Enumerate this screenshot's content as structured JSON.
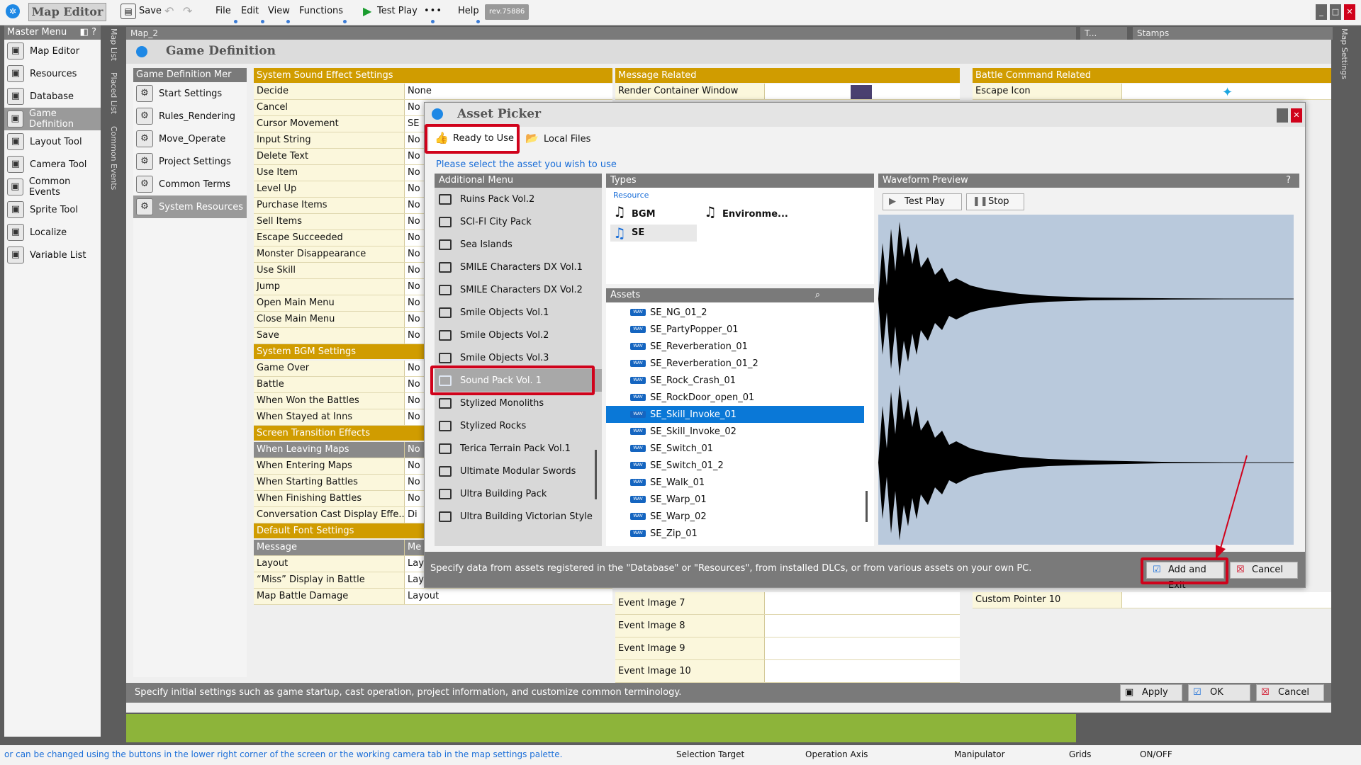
{
  "menubar": {
    "app_title": "Map Editor",
    "save": "Save",
    "file": "File",
    "edit": "Edit",
    "view": "View",
    "functions": "Functions",
    "test_play": "Test Play",
    "more": "•••",
    "help": "Help",
    "revision": "rev.75886"
  },
  "master_menu": {
    "title": "Master Menu",
    "items": [
      {
        "label": "Map Editor",
        "icon": "map-editor-icon"
      },
      {
        "label": "Resources",
        "icon": "resources-icon"
      },
      {
        "label": "Database",
        "icon": "database-icon"
      },
      {
        "label": "Game Definition",
        "icon": "game-definition-icon"
      },
      {
        "label": "Layout Tool",
        "icon": "layout-tool-icon"
      },
      {
        "label": "Camera Tool",
        "icon": "camera-icon"
      },
      {
        "label": "Common Events",
        "icon": "common-events-icon"
      },
      {
        "label": "Sprite Tool",
        "icon": "sprite-tool-icon"
      },
      {
        "label": "Localize",
        "icon": "localize-icon"
      },
      {
        "label": "Variable List",
        "icon": "variable-list-icon"
      }
    ],
    "selected": "Game Definition"
  },
  "side_tabs": {
    "map_list": "Map List",
    "placed_list": "Placed List",
    "common_events": "Common Events",
    "map_settings": "Map Settings"
  },
  "map_tab": "Map_2",
  "top_right_tabs": {
    "t": "T...",
    "stamps": "Stamps"
  },
  "game_definition": {
    "title": "Game Definition",
    "menu_title": "Game Definition Mer",
    "menu_items": [
      "Start Settings",
      "Rules_Rendering",
      "Move_Operate",
      "Project Settings",
      "Common Terms",
      "System Resources"
    ],
    "selected": "System Resources",
    "sound_title": "System Sound Effect Settings",
    "sound_rows": [
      {
        "k": "Decide",
        "v": "None"
      },
      {
        "k": "Cancel",
        "v": "No"
      },
      {
        "k": "Cursor Movement",
        "v": "SE"
      },
      {
        "k": "Input String",
        "v": "No"
      },
      {
        "k": "Delete Text",
        "v": "No"
      },
      {
        "k": "Use Item",
        "v": "No"
      },
      {
        "k": "Level Up",
        "v": "No"
      },
      {
        "k": "Purchase Items",
        "v": "No"
      },
      {
        "k": "Sell Items",
        "v": "No"
      },
      {
        "k": "Escape Succeeded",
        "v": "No"
      },
      {
        "k": "Monster Disappearance",
        "v": "No"
      },
      {
        "k": "Use Skill",
        "v": "No"
      },
      {
        "k": "Jump",
        "v": "No"
      },
      {
        "k": "Open Main Menu",
        "v": "No"
      },
      {
        "k": "Close Main Menu",
        "v": "No"
      },
      {
        "k": "Save",
        "v": "No"
      }
    ],
    "bgm_title": "System BGM Settings",
    "bgm_rows": [
      {
        "k": "Game Over",
        "v": "No"
      },
      {
        "k": "Battle",
        "v": "No"
      },
      {
        "k": "When Won the Battles",
        "v": "No"
      },
      {
        "k": "When Stayed at Inns",
        "v": "No"
      }
    ],
    "transition_title": "Screen Transition Effects",
    "transition_rows": [
      {
        "k": "When Leaving Maps",
        "v": "No"
      },
      {
        "k": "When Entering Maps",
        "v": "No"
      },
      {
        "k": "When Starting Battles",
        "v": "No"
      },
      {
        "k": "When Finishing Battles",
        "v": "No"
      },
      {
        "k": "Conversation Cast Display Effe...",
        "v": "Di"
      }
    ],
    "font_title": "Default Font Settings",
    "font_rows": [
      {
        "k": "Message",
        "v": "Me"
      },
      {
        "k": "Layout",
        "v": "Lay"
      },
      {
        "k": "“Miss” Display in Battle",
        "v": "Lay"
      },
      {
        "k": "Map Battle Damage",
        "v": "Layout"
      }
    ],
    "message_title": "Message Related",
    "message_first": "Render Container Window",
    "message_rows": [
      "Event Image 7",
      "Event Image 8",
      "Event Image 9",
      "Event Image 10"
    ],
    "battle_title": "Battle Command Related",
    "battle_first": "Escape Icon",
    "battle_last": "Custom Pointer 10",
    "footer": "Specify initial settings such as game startup, cast operation, project information, and customize common terminology.",
    "apply": "Apply",
    "ok": "OK",
    "cancel": "Cancel"
  },
  "asset_picker": {
    "title": "Asset Picker",
    "tab_ready": "Ready to Use",
    "tab_local": "Local Files",
    "instruction": "Please select the asset you wish to use",
    "additional_menu_title": "Additional Menu",
    "additional_menu": [
      "Ruins Pack Vol.2",
      "SCI-FI City Pack",
      "Sea Islands",
      "SMILE Characters DX Vol.1",
      "SMILE Characters DX Vol.2",
      "Smile Objects Vol.1",
      "Smile Objects Vol.2",
      "Smile Objects Vol.3",
      "Sound Pack Vol. 1",
      "Stylized Monoliths",
      "Stylized Rocks",
      "Terica Terrain Pack Vol.1",
      "Ultimate Modular Swords",
      "Ultra Building Pack",
      "Ultra Building Victorian Style"
    ],
    "selected_menu": "Sound Pack Vol. 1",
    "types_title": "Types",
    "resource_label": "Resource",
    "types": [
      "BGM",
      "Environme...",
      "SE"
    ],
    "selected_type": "SE",
    "assets_title": "Assets",
    "assets": [
      "SE_NG_01_2",
      "SE_PartyPopper_01",
      "SE_Reverberation_01",
      "SE_Reverberation_01_2",
      "SE_Rock_Crash_01",
      "SE_RockDoor_open_01",
      "SE_Skill_Invoke_01",
      "SE_Skill_Invoke_02",
      "SE_Switch_01",
      "SE_Switch_01_2",
      "SE_Walk_01",
      "SE_Warp_01",
      "SE_Warp_02",
      "SE_Zip_01"
    ],
    "selected_asset": "SE_Skill_Invoke_01",
    "wave_title": "Waveform Preview",
    "test_play": "Test Play",
    "stop": "Stop",
    "footer": "Specify data from assets registered in the \"Database\" or \"Resources\", from installed DLCs, or from various assets on your own PC.",
    "add_and_exit": "Add and Exit",
    "cancel": "Cancel"
  },
  "statusbar": {
    "hint": "or can be changed using the buttons in the lower right corner of the screen or the working camera tab in the map settings palette.",
    "selection_target": "Selection Target",
    "operation_axis": "Operation Axis",
    "manipulator": "Manipulator",
    "grids": "Grids",
    "onoff": "ON/OFF"
  },
  "colors": {
    "accent_gold": "#d09c00",
    "selection_blue": "#0a78d7",
    "highlight_red": "#d0021b",
    "waveform_bg": "#b9c9dc"
  }
}
